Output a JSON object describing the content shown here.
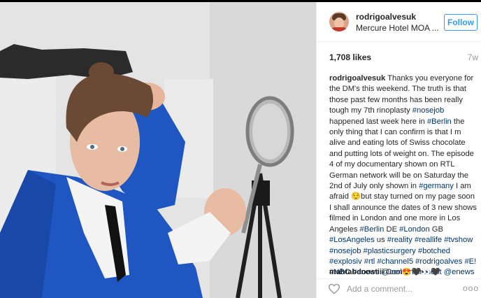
{
  "post": {
    "username": "rodrigoalvesuk",
    "location": "Mercure Hotel MOA ...",
    "follow_label": "Follow",
    "likes": "1,708 likes",
    "age": "7w",
    "caption_username": "rodrigoalvesuk",
    "caption": [
      {
        "t": "text",
        "v": " Thanks you everyone for the DM's this weekend. The truth is that those past few months has been really tough my 7th rinoplasty "
      },
      {
        "t": "tag",
        "v": "#nosejob"
      },
      {
        "t": "text",
        "v": " happened last week here in "
      },
      {
        "t": "tag",
        "v": "#Berlin"
      },
      {
        "t": "text",
        "v": " the only thing that I can confirm is that I m alive and eating lots of Swiss chocolate and putting lots of weight on. The episode 4 of my documentary shown on RTL German network will be on Saturday the 2nd of July only shown in "
      },
      {
        "t": "tag",
        "v": "#germany"
      },
      {
        "t": "text",
        "v": " I am afraid 😌but stay turned on my page soon I shall announce the dates of 3 new shows filmed in London and one more in Los Angeles "
      },
      {
        "t": "tag",
        "v": "#Berlin"
      },
      {
        "t": "text",
        "v": " DE "
      },
      {
        "t": "tag",
        "v": "#London"
      },
      {
        "t": "text",
        "v": " GB "
      },
      {
        "t": "tag",
        "v": "#LosAngeles"
      },
      {
        "t": "text",
        "v": " us "
      },
      {
        "t": "tag",
        "v": "#reality"
      },
      {
        "t": "text",
        "v": " "
      },
      {
        "t": "tag",
        "v": "#reallife"
      },
      {
        "t": "text",
        "v": " "
      },
      {
        "t": "tag",
        "v": "#tvshow"
      },
      {
        "t": "text",
        "v": " "
      },
      {
        "t": "tag",
        "v": "#nosejob"
      },
      {
        "t": "text",
        "v": " "
      },
      {
        "t": "tag",
        "v": "#plasticsurgery"
      },
      {
        "t": "text",
        "v": " "
      },
      {
        "t": "tag",
        "v": "#botched"
      },
      {
        "t": "text",
        "v": " "
      },
      {
        "t": "tag",
        "v": "#explosiv"
      },
      {
        "t": "text",
        "v": " "
      },
      {
        "t": "tag",
        "v": "#rtl"
      },
      {
        "t": "text",
        "v": " "
      },
      {
        "t": "tag",
        "v": "#channel5"
      },
      {
        "t": "text",
        "v": " "
      },
      {
        "t": "tag",
        "v": "#rodrigoalves"
      },
      {
        "t": "text",
        "v": " "
      },
      {
        "t": "tag",
        "v": "#E!"
      },
      {
        "t": "text",
        "v": " "
      },
      {
        "t": "tag",
        "v": "#NBC"
      },
      {
        "t": "text",
        "v": " "
      },
      {
        "t": "tag",
        "v": "#enews"
      },
      {
        "t": "text",
        "v": " "
      },
      {
        "t": "tag",
        "v": "@eentertainment"
      },
      {
        "t": "text",
        "v": " "
      },
      {
        "t": "tag",
        "v": "@enews"
      }
    ],
    "comment_username": "mahtabdoostiii",
    "comment_text": " Cool😍🖤👀🖤",
    "add_comment_placeholder": "Add a comment...",
    "more_label": "ooo"
  },
  "colors": {
    "accent": "#3897f0",
    "tag": "#003569",
    "muted": "#999999"
  },
  "icons": {
    "like": "heart-icon",
    "more": "more-options-icon",
    "avatar": "avatar"
  }
}
